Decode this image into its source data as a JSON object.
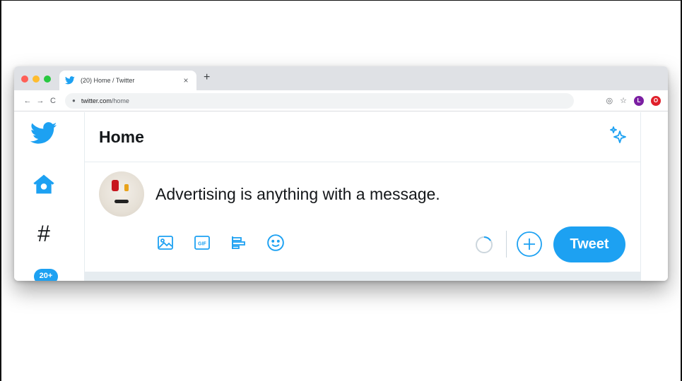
{
  "browser": {
    "tab_title": "(20) Home / Twitter",
    "tab_close": "×",
    "new_tab": "+",
    "url_host": "twitter.com",
    "url_path": "/home",
    "profile_letter": "L",
    "opera_letter": "O",
    "nav": {
      "back": "←",
      "forward": "→",
      "reload": "C"
    }
  },
  "sidebar": {
    "explore_glyph": "#",
    "notifications_badge": "20+"
  },
  "header": {
    "title": "Home"
  },
  "composer": {
    "text": "Advertising is anything with a message.",
    "gif_label": "GIF",
    "tweet_button": "Tweet"
  },
  "colors": {
    "brand": "#1da1f2",
    "text": "#14171a",
    "border": "#e6ecf0"
  },
  "icons": [
    "twitter-bird-icon",
    "home-icon",
    "explore-hash-icon",
    "sparkle-icon",
    "image-icon",
    "gif-icon",
    "poll-icon",
    "emoji-icon",
    "plus-circle-icon"
  ]
}
